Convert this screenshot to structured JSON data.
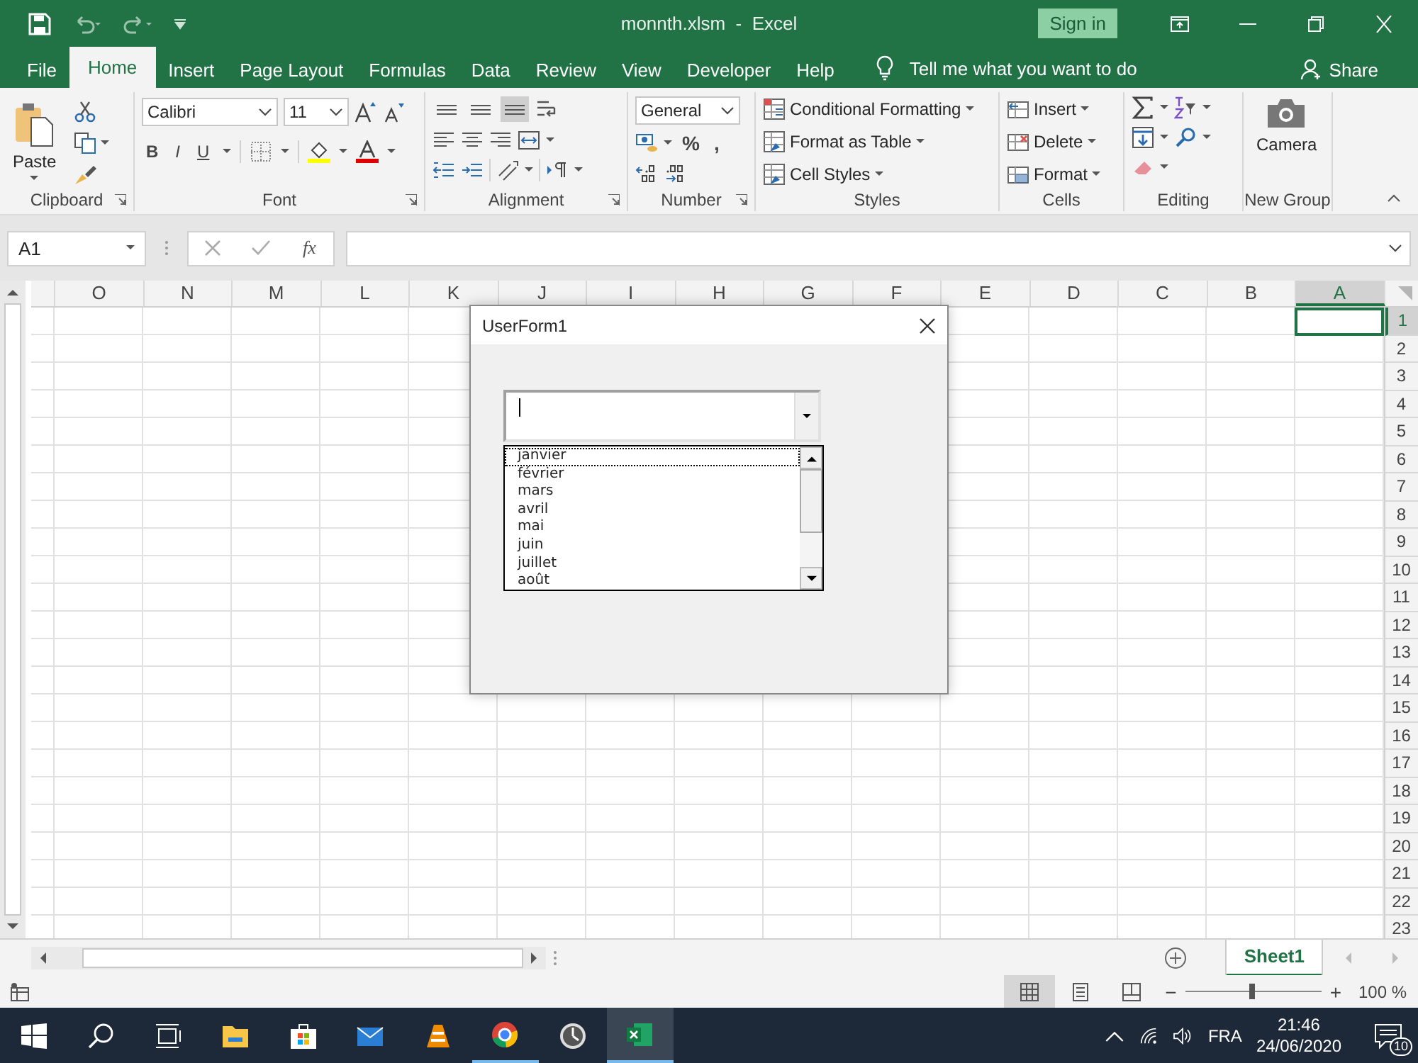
{
  "window": {
    "title": "monnth.xlsm  -  Excel",
    "sign_in": "Sign in"
  },
  "tabs": [
    {
      "label": "File",
      "selected": false
    },
    {
      "label": "Home",
      "selected": true
    },
    {
      "label": "Insert",
      "selected": false
    },
    {
      "label": "Page Layout",
      "selected": false
    },
    {
      "label": "Formulas",
      "selected": false
    },
    {
      "label": "Data",
      "selected": false
    },
    {
      "label": "Review",
      "selected": false
    },
    {
      "label": "View",
      "selected": false
    },
    {
      "label": "Developer",
      "selected": false
    },
    {
      "label": "Help",
      "selected": false
    }
  ],
  "tell_me": "Tell me what you want to do",
  "share": "Share",
  "ribbon": {
    "clipboard": {
      "paste": "Paste",
      "label": "Clipboard"
    },
    "font": {
      "name": "Calibri",
      "size": "11",
      "styles": [
        "B",
        "I",
        "U"
      ],
      "label": "Font"
    },
    "alignment": {
      "vertical": [
        {
          "selected": false
        },
        {
          "selected": false
        },
        {
          "selected": true
        }
      ],
      "label": "Alignment"
    },
    "number": {
      "format": "General",
      "symbols": [
        "%",
        ","
      ],
      "label": "Number"
    },
    "styles": {
      "items": [
        "Conditional Formatting",
        "Format as Table",
        "Cell Styles"
      ],
      "label": "Styles"
    },
    "cells": {
      "items": [
        "Insert",
        "Delete",
        "Format"
      ],
      "label": "Cells"
    },
    "editing": {
      "label": "Editing"
    },
    "new_group": {
      "button": "Camera",
      "label": "New Group"
    }
  },
  "formula_bar": {
    "name_box": "A1",
    "function_symbol": "fx"
  },
  "sheet": {
    "columns": [
      {
        "label": "O",
        "selected": false
      },
      {
        "label": "N",
        "selected": false
      },
      {
        "label": "M",
        "selected": false
      },
      {
        "label": "L",
        "selected": false
      },
      {
        "label": "K",
        "selected": false
      },
      {
        "label": "J",
        "selected": false
      },
      {
        "label": "I",
        "selected": false
      },
      {
        "label": "H",
        "selected": false
      },
      {
        "label": "G",
        "selected": false
      },
      {
        "label": "F",
        "selected": false
      },
      {
        "label": "E",
        "selected": false
      },
      {
        "label": "D",
        "selected": false
      },
      {
        "label": "C",
        "selected": false
      },
      {
        "label": "B",
        "selected": false
      },
      {
        "label": "A",
        "selected": true
      }
    ],
    "rows": [
      {
        "label": "1",
        "selected": true
      },
      {
        "label": "2",
        "selected": false
      },
      {
        "label": "3",
        "selected": false
      },
      {
        "label": "4",
        "selected": false
      },
      {
        "label": "5",
        "selected": false
      },
      {
        "label": "6",
        "selected": false
      },
      {
        "label": "7",
        "selected": false
      },
      {
        "label": "8",
        "selected": false
      },
      {
        "label": "9",
        "selected": false
      },
      {
        "label": "10",
        "selected": false
      },
      {
        "label": "11",
        "selected": false
      },
      {
        "label": "12",
        "selected": false
      },
      {
        "label": "13",
        "selected": false
      },
      {
        "label": "14",
        "selected": false
      },
      {
        "label": "15",
        "selected": false
      },
      {
        "label": "16",
        "selected": false
      },
      {
        "label": "17",
        "selected": false
      },
      {
        "label": "18",
        "selected": false
      },
      {
        "label": "19",
        "selected": false
      },
      {
        "label": "20",
        "selected": false
      },
      {
        "label": "21",
        "selected": false
      },
      {
        "label": "22",
        "selected": false
      },
      {
        "label": "23",
        "selected": false
      }
    ]
  },
  "dialog": {
    "title": "UserForm1",
    "list_items": [
      {
        "label": "janvier",
        "focused": true
      },
      {
        "label": "février",
        "focused": false
      },
      {
        "label": "mars",
        "focused": false
      },
      {
        "label": "avril",
        "focused": false
      },
      {
        "label": "mai",
        "focused": false
      },
      {
        "label": "juin",
        "focused": false
      },
      {
        "label": "juillet",
        "focused": false
      },
      {
        "label": "août",
        "focused": false
      }
    ]
  },
  "sheet_tabs": [
    {
      "label": "Sheet1",
      "selected": true
    }
  ],
  "status_bar": {
    "views": [
      {
        "kind": "normal",
        "selected": true
      },
      {
        "kind": "page-layout",
        "selected": false
      },
      {
        "kind": "page-break",
        "selected": false
      }
    ],
    "zoom_out": "−",
    "zoom_in": "+",
    "zoom": {
      "level": 0.49
    },
    "zoom_reading": "100 %"
  },
  "taskbar": {
    "apps": [
      {
        "kind": "start",
        "running": false,
        "selected": false
      },
      {
        "kind": "search",
        "running": false,
        "selected": false
      },
      {
        "kind": "task-view",
        "running": false,
        "selected": false
      },
      {
        "kind": "files",
        "running": false,
        "selected": false
      },
      {
        "kind": "store",
        "running": false,
        "selected": false
      },
      {
        "kind": "mail",
        "running": false,
        "selected": false
      },
      {
        "kind": "media",
        "running": false,
        "selected": false
      },
      {
        "kind": "browser",
        "running": true,
        "selected": false
      },
      {
        "kind": "clock",
        "running": false,
        "selected": false
      },
      {
        "kind": "spreadsheet",
        "running": true,
        "selected": true
      }
    ],
    "language": "FRA",
    "time": "21:46",
    "date": "24/06/2020",
    "notifications": "10"
  }
}
